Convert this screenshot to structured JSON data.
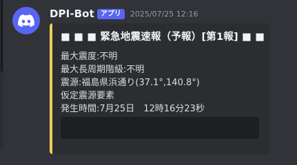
{
  "message": {
    "author": "DPI-Bot",
    "badge": "アプリ",
    "timestamp": "2025/07/25 12:16",
    "avatar_icon": "discord-logo-icon",
    "avatar_color": "#5865f2"
  },
  "embed": {
    "accent_color": "#f0cf5a",
    "title": "■ ■ ■ 緊急地震速報（予報）[第1報] ■ ■",
    "lines": [
      "最大震度:不明",
      "最大長周期階級:不明",
      "震源:福島県浜通り(37.1°,140.8°)",
      "仮定震源要素",
      "発生時間:7月25日　12時16分23秒"
    ]
  }
}
